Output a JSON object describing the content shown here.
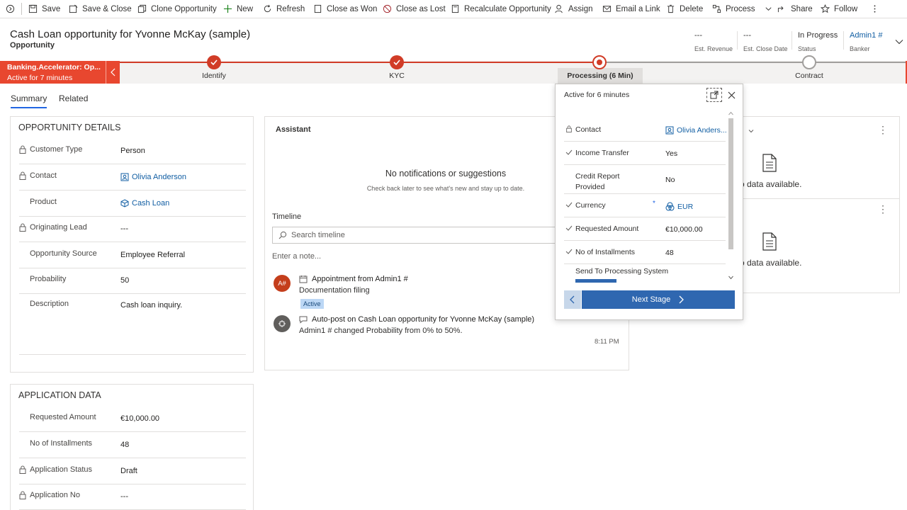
{
  "toolbar": {
    "save": "Save",
    "save_close": "Save & Close",
    "clone": "Clone Opportunity",
    "new": "New",
    "refresh": "Refresh",
    "close_won": "Close as Won",
    "close_lost": "Close as Lost",
    "recalc": "Recalculate Opportunity",
    "assign": "Assign",
    "email_link": "Email a Link",
    "delete": "Delete",
    "process": "Process",
    "share": "Share",
    "follow": "Follow"
  },
  "header": {
    "title": "Cash Loan opportunity for Yvonne McKay (sample)",
    "entity": "Opportunity",
    "fields": [
      {
        "value": "---",
        "label": "Est. Revenue"
      },
      {
        "value": "---",
        "label": "Est. Close Date"
      },
      {
        "value": "In Progress",
        "label": "Status"
      },
      {
        "value": "Admin1 #",
        "label": "Banker"
      }
    ]
  },
  "bpf": {
    "name": "Banking.Accelerator: Op...",
    "active_for": "Active for 7 minutes",
    "stages": [
      {
        "label": "Identify",
        "state": "done"
      },
      {
        "label": "KYC",
        "state": "done"
      },
      {
        "label": "Processing  (6 Min)",
        "state": "active"
      },
      {
        "label": "Contract",
        "state": "pending"
      }
    ]
  },
  "tabs": [
    "Summary",
    "Related"
  ],
  "opportunity_details": {
    "header": "OPPORTUNITY DETAILS",
    "rows": [
      {
        "label": "Customer Type",
        "value": "Person",
        "locked": true
      },
      {
        "label": "Contact",
        "value": "Olivia Anderson",
        "locked": true
      },
      {
        "label": "Product",
        "value": "Cash Loan",
        "locked": false
      },
      {
        "label": "Originating Lead",
        "value": "---",
        "locked": true
      },
      {
        "label": "Opportunity Source",
        "value": "Employee Referral",
        "locked": false
      },
      {
        "label": "Probability",
        "value": "50",
        "locked": false
      },
      {
        "label": "Description",
        "value": "Cash loan inquiry.",
        "locked": false
      }
    ]
  },
  "application_data": {
    "header": "APPLICATION DATA",
    "rows": [
      {
        "label": "Requested Amount",
        "value": "€10,000.00",
        "locked": false
      },
      {
        "label": "No of Installments",
        "value": "48",
        "locked": false
      },
      {
        "label": "Application Status",
        "value": "Draft",
        "locked": true
      },
      {
        "label": "Application No",
        "value": "---",
        "locked": true
      }
    ]
  },
  "assistant": {
    "header": "Assistant",
    "empty_title": "No notifications or suggestions",
    "empty_sub": "Check back later to see what's new and stay up to date."
  },
  "timeline": {
    "header": "Timeline",
    "search_placeholder": "Search timeline",
    "note_placeholder": "Enter a note...",
    "items": [
      {
        "avatar": "A#",
        "title": "Appointment from Admin1 #",
        "sub": "Documentation filing",
        "badge": "Active"
      },
      {
        "title": "Auto-post on Cash Loan opportunity for Yvonne McKay (sample)",
        "sub": "Admin1 # changed Probability from 0% to 50%."
      }
    ],
    "time": "8:11 PM"
  },
  "right_panels": {
    "no_data_1": "o data available.",
    "no_data_2": "o data available."
  },
  "flyout": {
    "header": "Active for 6 minutes",
    "rows": [
      {
        "label": "Contact",
        "value": "Olivia Anders...",
        "icon": "lock"
      },
      {
        "label": "Income Transfer",
        "value": "Yes",
        "icon": "check"
      },
      {
        "label": "Credit Report Provided",
        "value": "No",
        "icon": ""
      },
      {
        "label": "Currency",
        "value": "EUR",
        "icon": "check"
      },
      {
        "label": "Requested Amount",
        "value": "€10,000.00",
        "icon": "check"
      },
      {
        "label": "No of Installments",
        "value": "48",
        "icon": "check"
      },
      {
        "label": "Send To Processing System",
        "value": "",
        "icon": ""
      }
    ],
    "next_stage": "Next Stage"
  },
  "colors": {
    "accent_red": "#d13c27",
    "bpf_flag": "#e8472f",
    "link_blue": "#115ea3",
    "next_stage_blue": "#2f67b0"
  }
}
